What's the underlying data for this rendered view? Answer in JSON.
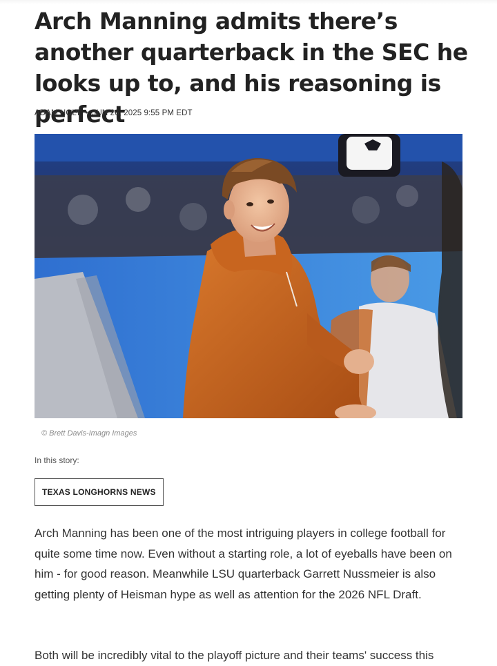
{
  "article": {
    "headline": "Arch Manning admits there’s another quarterback in the SEC he looks up to, and his reasoning is perfect",
    "author": "ADAM HOLT",
    "separator": "•",
    "date": "JUN 26, 2025 9:55 PM EDT",
    "photo_credit": "© Brett Davis-Imagn Images",
    "story_label": "In this story:",
    "story_tag": "TEXAS LONGHORNS NEWS",
    "paragraphs": [
      "Arch Manning has been one of the most intriguing players in college football for quite some time now. Even without a starting role, a lot of eyeballs have been on him - for good reason. Meanwhile LSU quarterback Garrett Nussmeier is also getting plenty of Heisman hype as well as attention for the 2026 NFL Draft.",
      "Both will be incredibly vital to the playoff picture and their teams' success this"
    ]
  },
  "colors": {
    "text": "#222222",
    "body_text": "#333333",
    "caption": "#8a8a8a",
    "hoodie": "#c8651f"
  }
}
